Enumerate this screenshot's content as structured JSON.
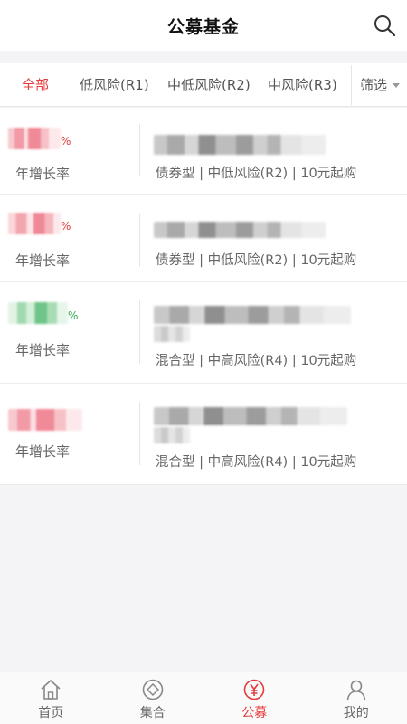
{
  "header": {
    "title": "公募基金"
  },
  "tabs": [
    {
      "label": "全部",
      "active": true
    },
    {
      "label": "低风险(R1)",
      "active": false
    },
    {
      "label": "中低风险(R2)",
      "active": false
    },
    {
      "label": "中风险(R3)",
      "active": false
    }
  ],
  "filter": {
    "label": "筛选"
  },
  "funds": [
    {
      "rate_label": "年增长率",
      "meta": "债券型 | 中低风险(R2) | 10元起购",
      "trend": "up"
    },
    {
      "rate_label": "年增长率",
      "meta": "债券型 | 中低风险(R2) | 10元起购",
      "trend": "up"
    },
    {
      "rate_label": "年增长率",
      "meta": "混合型 | 中高风险(R4) | 10元起购",
      "trend": "down"
    },
    {
      "rate_label": "年增长率",
      "meta": "混合型 | 中高风险(R4) | 10元起购",
      "trend": "up"
    }
  ],
  "percent_sign": "%",
  "bottom_nav": [
    {
      "label": "首页",
      "icon": "home-icon",
      "active": false
    },
    {
      "label": "集合",
      "icon": "collection-icon",
      "active": false
    },
    {
      "label": "公募",
      "icon": "fund-yen-icon",
      "active": true
    },
    {
      "label": "我的",
      "icon": "profile-icon",
      "active": false
    }
  ],
  "colors": {
    "accent": "#e53a3a",
    "up": "#e53a3a",
    "down": "#2fa84f"
  }
}
